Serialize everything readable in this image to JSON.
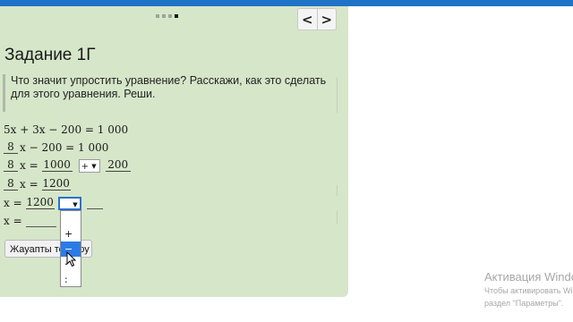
{
  "pager": {
    "dots": 4,
    "active_index": 3
  },
  "nav": {
    "prev_label": "<",
    "next_label": ">"
  },
  "task": {
    "title": "Задание 1Г",
    "instruction": "Что значит упростить уравнение? Расскажи, как это сделать для этого уравнения. Реши."
  },
  "equations": {
    "line1": "5x + 3x − 200 = 1 000",
    "line2_answer": "8",
    "line2_rest": "x − 200 = 1 000",
    "line3_answer": "8",
    "line3_mid": "x =",
    "line3_value": "1000",
    "line3_operator": "+",
    "line3_operand": "200",
    "line4_answer": "8",
    "line4_mid": "x =",
    "line4_value": "1200",
    "line5_prefix": "x =",
    "line5_value": "1200",
    "line6_prefix": "x ="
  },
  "operator_options": [
    "",
    "+",
    "−",
    "·",
    ":"
  ],
  "operator_highlighted": "−",
  "check_button": {
    "label": "Жауапты тексеру"
  },
  "watermark": {
    "title": "Активация Windows",
    "line1": "Чтобы активировать Windows,",
    "line2": "раздел \"Параметры\"."
  },
  "colors": {
    "panel": "#d6e6c9",
    "topbar": "#1e73c6",
    "highlight": "#2c7be5"
  }
}
